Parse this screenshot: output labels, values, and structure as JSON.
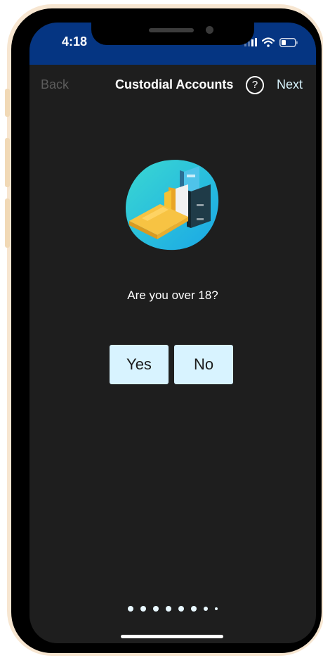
{
  "status_bar": {
    "time": "4:18",
    "icons": [
      "signal-icon",
      "wifi-icon",
      "battery-icon"
    ],
    "color": "#053582"
  },
  "nav": {
    "back_label": "Back",
    "title": "Custodial Accounts",
    "help_label": "?",
    "next_label": "Next"
  },
  "content": {
    "illustration": "files-folder-illustration",
    "question": "Are you over 18?",
    "yes_label": "Yes",
    "no_label": "No"
  },
  "pagination": {
    "total_pages": 8
  },
  "colors": {
    "background": "#1e1e1e",
    "button": "#d8f3ff",
    "accent": "#d9f5ff"
  }
}
